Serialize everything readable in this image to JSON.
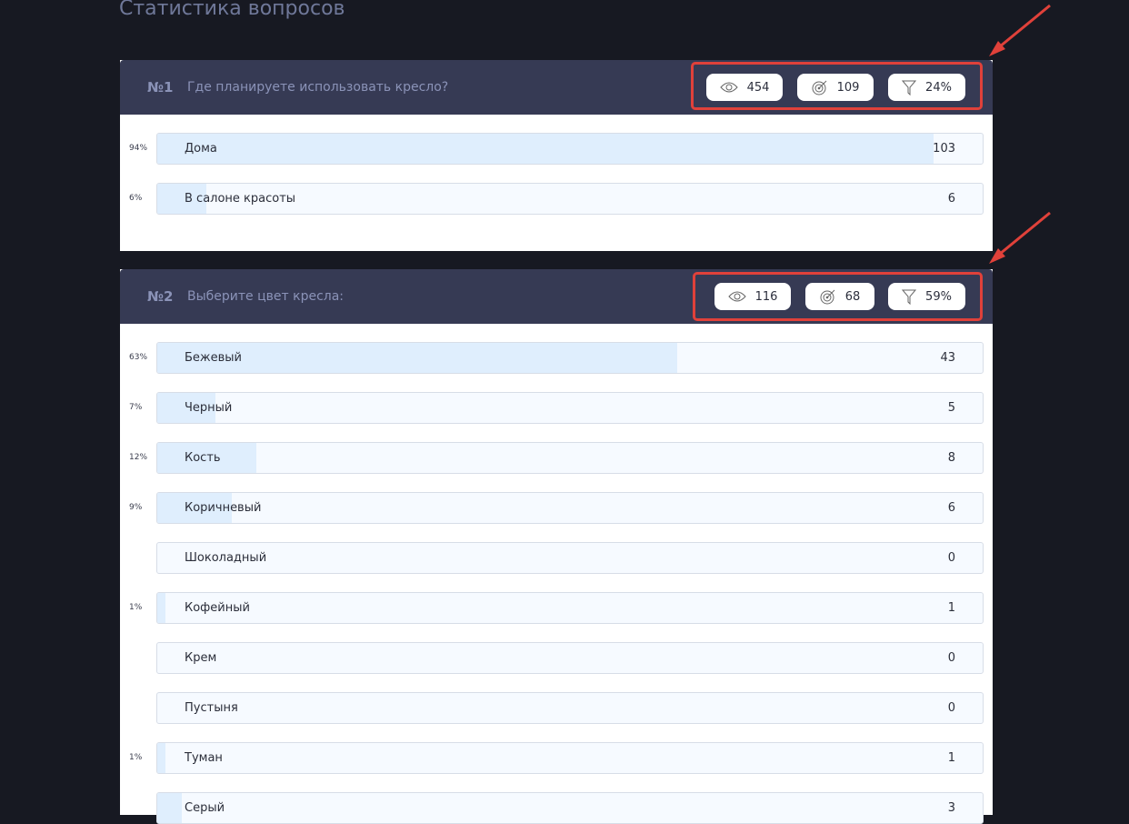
{
  "page": {
    "title": "Статистика вопросов"
  },
  "questions": [
    {
      "number": "№1",
      "text": "Где планируете использовать кресло?",
      "stats": {
        "views": "454",
        "answers": "109",
        "conversion": "24%"
      },
      "options": [
        {
          "percent": "94%",
          "label": "Дома",
          "count": "103",
          "share": 0.94
        },
        {
          "percent": "6%",
          "label": "В салоне красоты",
          "count": "6",
          "share": 0.06
        }
      ]
    },
    {
      "number": "№2",
      "text": "Выберите цвет кресла:",
      "stats": {
        "views": "116",
        "answers": "68",
        "conversion": "59%"
      },
      "options": [
        {
          "percent": "63%",
          "label": "Бежевый",
          "count": "43",
          "share": 0.63
        },
        {
          "percent": "7%",
          "label": "Черный",
          "count": "5",
          "share": 0.07
        },
        {
          "percent": "12%",
          "label": "Кость",
          "count": "8",
          "share": 0.12
        },
        {
          "percent": "9%",
          "label": "Коричневый",
          "count": "6",
          "share": 0.09
        },
        {
          "percent": "",
          "label": "Шоколадный",
          "count": "0",
          "share": 0
        },
        {
          "percent": "1%",
          "label": "Кофейный",
          "count": "1",
          "share": 0.01
        },
        {
          "percent": "",
          "label": "Крем",
          "count": "0",
          "share": 0
        },
        {
          "percent": "",
          "label": "Пустыня",
          "count": "0",
          "share": 0
        },
        {
          "percent": "1%",
          "label": "Туман",
          "count": "1",
          "share": 0.01
        },
        {
          "percent": "",
          "label": "Серый",
          "count": "3",
          "share": 0.03
        }
      ]
    }
  ],
  "icons": {
    "views": "eye-icon",
    "answers": "target-icon",
    "conversion": "funnel-icon"
  },
  "colors": {
    "background": "#171922",
    "header": "#363a54",
    "bar_fill": "#dfeefd",
    "bar_track": "#f6faff",
    "annotation": "#e0413a"
  }
}
